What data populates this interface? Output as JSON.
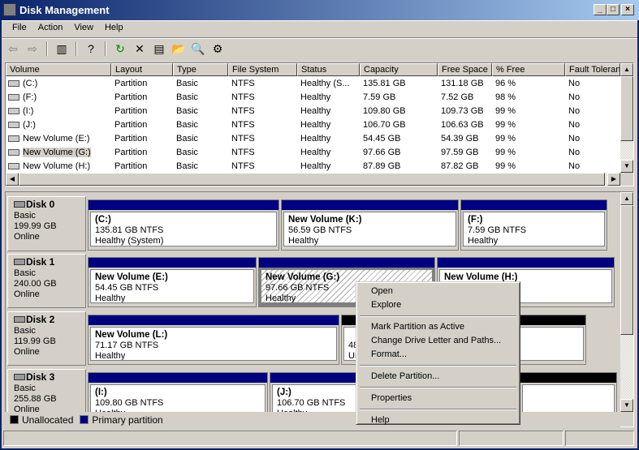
{
  "window": {
    "title": "Disk Management",
    "minimize": "_",
    "maximize": "□",
    "close": "×"
  },
  "menu": [
    "File",
    "Action",
    "View",
    "Help"
  ],
  "toolbar": [
    {
      "icon": "back-arrow-icon",
      "glyph": "⇦"
    },
    {
      "icon": "forward-arrow-icon",
      "glyph": "⇨"
    },
    {
      "sep": true
    },
    {
      "icon": "show-hide-tree-icon",
      "glyph": "▥"
    },
    {
      "sep": true
    },
    {
      "icon": "help-icon",
      "glyph": "?"
    },
    {
      "sep": true
    },
    {
      "icon": "refresh-icon",
      "glyph": "↻"
    },
    {
      "icon": "delete-icon",
      "glyph": "✕"
    },
    {
      "icon": "properties-icon",
      "glyph": "▤"
    },
    {
      "icon": "open-folder-icon",
      "glyph": "📂"
    },
    {
      "icon": "explore-icon",
      "glyph": "🔍"
    },
    {
      "icon": "settings-icon",
      "glyph": "⚙"
    }
  ],
  "volume_list": {
    "columns": [
      "Volume",
      "Layout",
      "Type",
      "File System",
      "Status",
      "Capacity",
      "Free Space",
      "% Free",
      "Fault Toleran"
    ],
    "rows": [
      [
        "(C:)",
        "Partition",
        "Basic",
        "NTFS",
        "Healthy (S...",
        "135.81 GB",
        "131.18 GB",
        "96 %",
        "No"
      ],
      [
        "(F:)",
        "Partition",
        "Basic",
        "NTFS",
        "Healthy",
        "7.59 GB",
        "7.52 GB",
        "98 %",
        "No"
      ],
      [
        "(I:)",
        "Partition",
        "Basic",
        "NTFS",
        "Healthy",
        "109.80 GB",
        "109.73 GB",
        "99 %",
        "No"
      ],
      [
        "(J:)",
        "Partition",
        "Basic",
        "NTFS",
        "Healthy",
        "106.70 GB",
        "106.63 GB",
        "99 %",
        "No"
      ],
      [
        "New Volume (E:)",
        "Partition",
        "Basic",
        "NTFS",
        "Healthy",
        "54.45 GB",
        "54.39 GB",
        "99 %",
        "No"
      ],
      [
        "New Volume (G:)",
        "Partition",
        "Basic",
        "NTFS",
        "Healthy",
        "97.66 GB",
        "97.59 GB",
        "99 %",
        "No"
      ],
      [
        "New Volume (H:)",
        "Partition",
        "Basic",
        "NTFS",
        "Healthy",
        "87.89 GB",
        "87.82 GB",
        "99 %",
        "No"
      ]
    ],
    "selected_row": 5
  },
  "disks": [
    {
      "name": "Disk 0",
      "type": "Basic",
      "size": "199.99 GB",
      "state": "Online",
      "partitions": [
        {
          "name": "(C:)",
          "size": "135.81 GB NTFS",
          "status": "Healthy (System)"
        },
        {
          "name": "New Volume  (K:)",
          "size": "56.59 GB NTFS",
          "status": "Healthy"
        },
        {
          "name": "(F:)",
          "size": "7.59 GB NTFS",
          "status": "Healthy"
        }
      ]
    },
    {
      "name": "Disk 1",
      "type": "Basic",
      "size": "240.00 GB",
      "state": "Online",
      "partitions": [
        {
          "name": "New Volume  (E:)",
          "size": "54.45 GB NTFS",
          "status": "Healthy"
        },
        {
          "name": "New Volume  (G:)",
          "size": "97.66 GB NTFS",
          "status": "Healthy",
          "selected": true
        },
        {
          "name": "New Volume  (H:)",
          "size": "",
          "status": ""
        }
      ]
    },
    {
      "name": "Disk 2",
      "type": "Basic",
      "size": "119.99 GB",
      "state": "Online",
      "partitions": [
        {
          "name": "New Volume  (L:)",
          "size": "71.17 GB NTFS",
          "status": "Healthy"
        },
        {
          "name": "",
          "size": "48.82 GB",
          "status": "Unallocated",
          "unallocated": true
        }
      ]
    },
    {
      "name": "Disk 3",
      "type": "Basic",
      "size": "255.88 GB",
      "state": "Online",
      "partitions": [
        {
          "name": "(I:)",
          "size": "109.80 GB NTFS",
          "status": "Healthy"
        },
        {
          "name": "(J:)",
          "size": "106.70 GB NTFS",
          "status": "Healthy"
        },
        {
          "name": "",
          "size": "",
          "status": "",
          "unallocated": true
        }
      ]
    }
  ],
  "legend": {
    "unallocated": "Unallocated",
    "primary": "Primary partition",
    "colors": {
      "unallocated": "#000000",
      "primary": "#000080"
    }
  },
  "context_menu": {
    "groups": [
      [
        "Open",
        "Explore"
      ],
      [
        "Mark Partition as Active",
        "Change Drive Letter and Paths...",
        "Format..."
      ],
      [
        "Delete Partition..."
      ],
      [
        "Properties"
      ],
      [
        "Help"
      ]
    ]
  }
}
